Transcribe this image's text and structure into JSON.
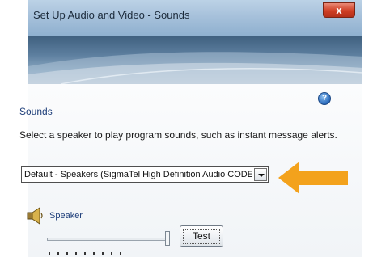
{
  "window": {
    "title": "Set Up Audio and Video - Sounds",
    "close_label": "x"
  },
  "help_label": "?",
  "sounds": {
    "section_title": "Sounds",
    "description": "Select a speaker to play program sounds, such as instant message alerts.",
    "device_selected": "Default - Speakers (SigmaTel High Definition Audio CODEC)"
  },
  "speaker": {
    "label": "Speaker",
    "volume_level": 0.98,
    "test_label": "Test"
  },
  "colors": {
    "annotation_arrow": "#f3a21c",
    "close_button": "#cf3e23",
    "section_title": "#1f3f7a"
  }
}
